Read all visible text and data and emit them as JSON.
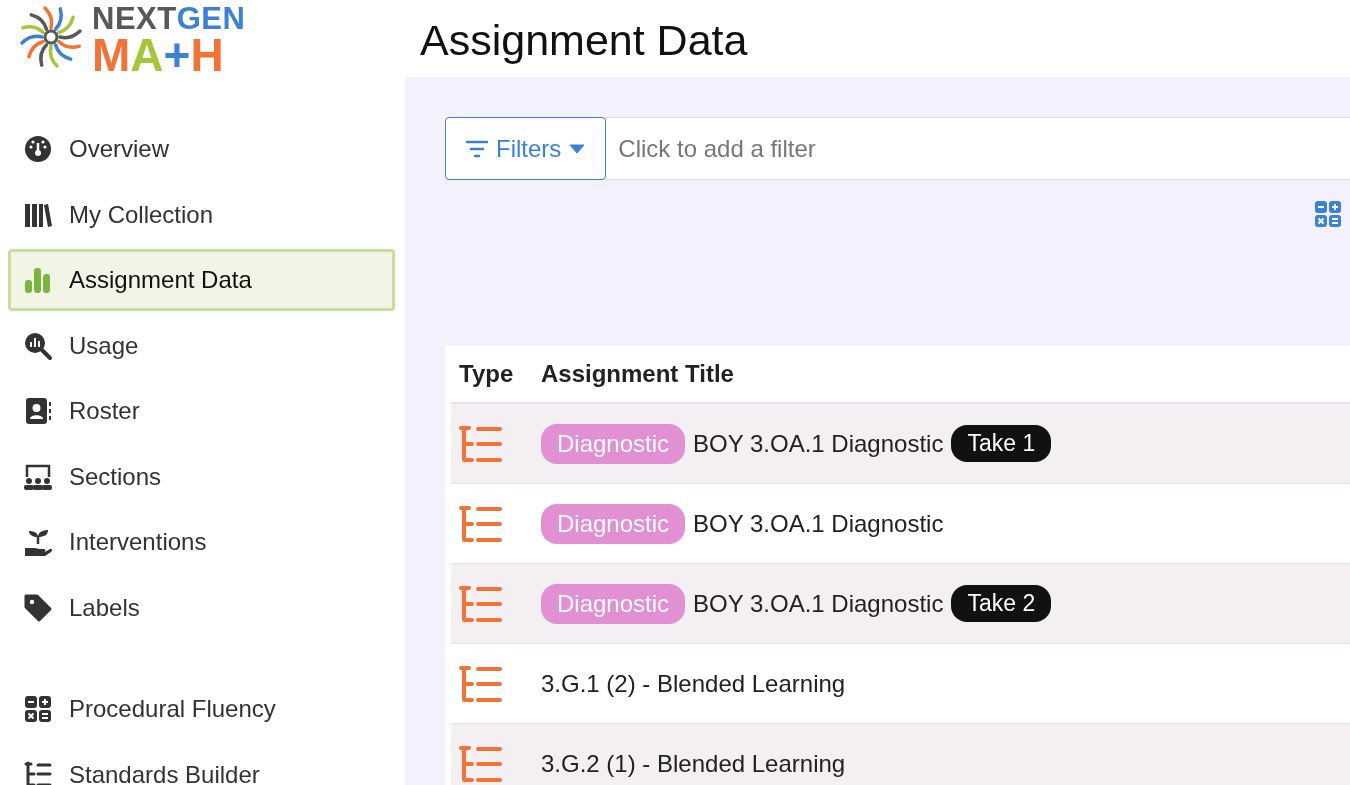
{
  "logo": {
    "line1": [
      {
        "text": "NEXT",
        "color": "#58585b"
      },
      {
        "text": "GEN",
        "color": "#3b82d6"
      }
    ],
    "line2": [
      {
        "text": "M",
        "color": "#f37336"
      },
      {
        "text": "A",
        "color": "#a4c639"
      },
      {
        "text": "+",
        "color": "#3b82d6"
      },
      {
        "text": "H",
        "color": "#f37336"
      }
    ]
  },
  "page_title": "Assignment Data",
  "sidebar": {
    "items": [
      {
        "label": "Overview",
        "selected": false
      },
      {
        "label": "My Collection",
        "selected": false
      },
      {
        "label": "Assignment Data",
        "selected": true
      },
      {
        "label": "Usage",
        "selected": false
      },
      {
        "label": "Roster",
        "selected": false
      },
      {
        "label": "Sections",
        "selected": false
      },
      {
        "label": "Interventions",
        "selected": false
      },
      {
        "label": "Labels",
        "selected": false
      }
    ],
    "tools": [
      {
        "label": "Procedural Fluency",
        "selected": false
      },
      {
        "label": "Standards Builder",
        "selected": false
      }
    ]
  },
  "filter_bar": {
    "button": "Filters",
    "placeholder": "Click to add a filter"
  },
  "table": {
    "columns": [
      "Type",
      "Assignment Title"
    ],
    "rows": [
      {
        "tag": "Diagnostic",
        "title": "BOY 3.OA.1 Diagnostic",
        "take": "Take 1"
      },
      {
        "tag": "Diagnostic",
        "title": "BOY 3.OA.1 Diagnostic"
      },
      {
        "tag": "Diagnostic",
        "title": "BOY 3.OA.1 Diagnostic",
        "take": "Take 2"
      },
      {
        "title": "3.G.1 (2) - Blended Learning"
      },
      {
        "title": "3.G.2 (1) - Blended Learning"
      }
    ]
  }
}
